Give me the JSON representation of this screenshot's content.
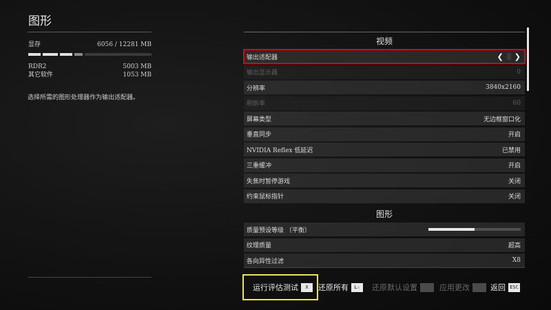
{
  "left": {
    "title": "图形",
    "memory": {
      "vram_label": "显存",
      "vram_value": "6056 / 12281 MB",
      "vram_fraction": 0.49,
      "rows": [
        {
          "label": "RDR2",
          "value": "5003 MB"
        },
        {
          "label": "其它软件",
          "value": "1053 MB"
        }
      ]
    },
    "description": "选择所需的图形处理器作为输出适配器。"
  },
  "panel": {
    "sections": [
      {
        "header": "视频",
        "rows": [
          {
            "label": "输出适配器",
            "value": "",
            "state": "selected",
            "has_arrows": true
          },
          {
            "label": "输出显示器",
            "value": "0",
            "state": "disabled"
          },
          {
            "label": "分辨率",
            "value": "3840x2160",
            "state": "normal"
          },
          {
            "label": "刷新率",
            "value": "60",
            "state": "disabled"
          },
          {
            "label": "屏幕类型",
            "value": "无边框窗口化",
            "state": "normal"
          },
          {
            "label": "垂直同步",
            "value": "开启",
            "state": "normal"
          },
          {
            "label": "NVIDIA  Reflex  低延迟",
            "value": "已禁用",
            "state": "normal"
          },
          {
            "label": "三重缓冲",
            "value": "开启",
            "state": "normal"
          },
          {
            "label": "失焦时暂停游戏",
            "value": "关闭",
            "state": "normal"
          },
          {
            "label": "约束鼠标指针",
            "value": "关闭",
            "state": "normal"
          }
        ]
      },
      {
        "header": "图形",
        "rows": [
          {
            "label": "质量预设等级  （平衡）",
            "value": "",
            "state": "slider",
            "slider_fraction": 0.5
          },
          {
            "label": "纹理质量",
            "value": "超高",
            "state": "normal"
          },
          {
            "label": "各向异性过滤",
            "value": "X8",
            "state": "normal"
          }
        ]
      }
    ]
  },
  "actions": [
    {
      "label": "运行评估测试",
      "key": "X",
      "state": "highlighted"
    },
    {
      "label": "还原所有",
      "key": "L☆",
      "state": "normal"
    },
    {
      "label": "还原默认设置",
      "key": "",
      "state": "disabled"
    },
    {
      "label": "应用更改",
      "key": "",
      "state": "disabled"
    },
    {
      "label": "返回",
      "key": "ESC",
      "state": "normal"
    }
  ],
  "colors": {
    "selected_outline": "#b3161c",
    "highlight_box": "#f0e83a",
    "scrollbar": "#e6e6e6"
  }
}
